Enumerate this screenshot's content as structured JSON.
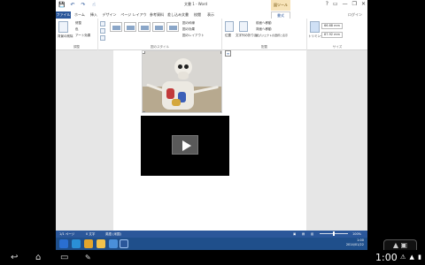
{
  "window": {
    "title": "文書 1 - Word",
    "context_group": "図ツール",
    "user": "ログイン",
    "controls": [
      "?",
      "▭",
      "—",
      "❐",
      "✕"
    ]
  },
  "qat": {
    "save": "💾",
    "undo": "↶",
    "redo": "↷",
    "touch": "☝"
  },
  "tabs": [
    {
      "label": "ファイル"
    },
    {
      "label": "ホーム"
    },
    {
      "label": "挿入"
    },
    {
      "label": "デザイン"
    },
    {
      "label": "ページ レイアウト"
    },
    {
      "label": "参考資料"
    },
    {
      "label": "差し込み文書"
    },
    {
      "label": "校閲"
    },
    {
      "label": "表示"
    },
    {
      "label": "書式"
    }
  ],
  "ribbon": {
    "adjust": {
      "label": "調整",
      "items": [
        "背景の削除",
        "修整",
        "色",
        "アート効果"
      ]
    },
    "styles": {
      "label": "図のスタイル",
      "items": [
        "図の枠線",
        "図の効果",
        "図のレイアウト"
      ]
    },
    "arrange": {
      "label": "配置",
      "items": [
        "位置",
        "文字列の折り返し",
        "前面へ移動",
        "背面へ移動",
        "オブジェクトの選択と表示"
      ]
    },
    "size": {
      "label": "サイズ",
      "crop": "トリミング",
      "height": "66.68 mm",
      "width": "87.92 mm"
    }
  },
  "status": {
    "page": "1/1 ページ",
    "words": "0 文字",
    "lang": "英語 (米国)",
    "zoom": "100%",
    "zoom_value": 0.5
  },
  "taskbar": {
    "time": "1:00",
    "date": "2014/01/22"
  },
  "android": {
    "clock": "1:00",
    "icons": "⚠ ▲ ▮",
    "back": "↩",
    "home": "⌂",
    "recent": "▭",
    "apps": "✎",
    "side": "▲ ▣"
  },
  "colors": {
    "accent": "#2b579a",
    "taskbar": "#1f4f8b",
    "context": "#f7e3b8"
  }
}
